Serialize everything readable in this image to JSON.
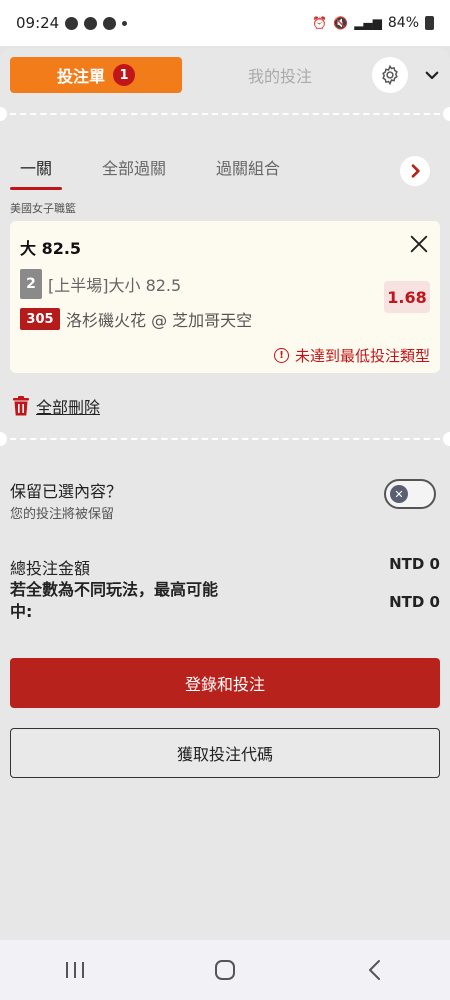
{
  "status_bar": {
    "time": "09:24",
    "battery": "84%"
  },
  "header": {
    "bet_slip_tab": "投注單",
    "bet_count": "1",
    "my_bets_tab": "我的投注"
  },
  "subtabs": [
    "一關",
    "全部過關",
    "過關組合"
  ],
  "league": "美國女子職籃",
  "bet": {
    "title": "大 82.5",
    "market_number": "2",
    "market_text": "[上半場]大小 82.5",
    "odds": "1.68",
    "event_number": "305",
    "event_text": "洛杉磯火花 @ 芝加哥天空",
    "warning": "未達到最低投注類型"
  },
  "delete_all": "全部刪除",
  "keep": {
    "title": "保留已選內容？",
    "subtitle": "您的投注將被保留",
    "enabled": false
  },
  "totals": {
    "total_label": "總投注金額",
    "total_value": "NTD 0",
    "max_label": "若全數為不同玩法，最高可能中:",
    "max_value": "NTD 0"
  },
  "buttons": {
    "login_bet": "登錄和投注",
    "get_code": "獲取投注代碼"
  },
  "colors": {
    "accent_orange": "#f27b1a",
    "accent_red": "#b8221d",
    "card_bg": "#fdfaef"
  }
}
